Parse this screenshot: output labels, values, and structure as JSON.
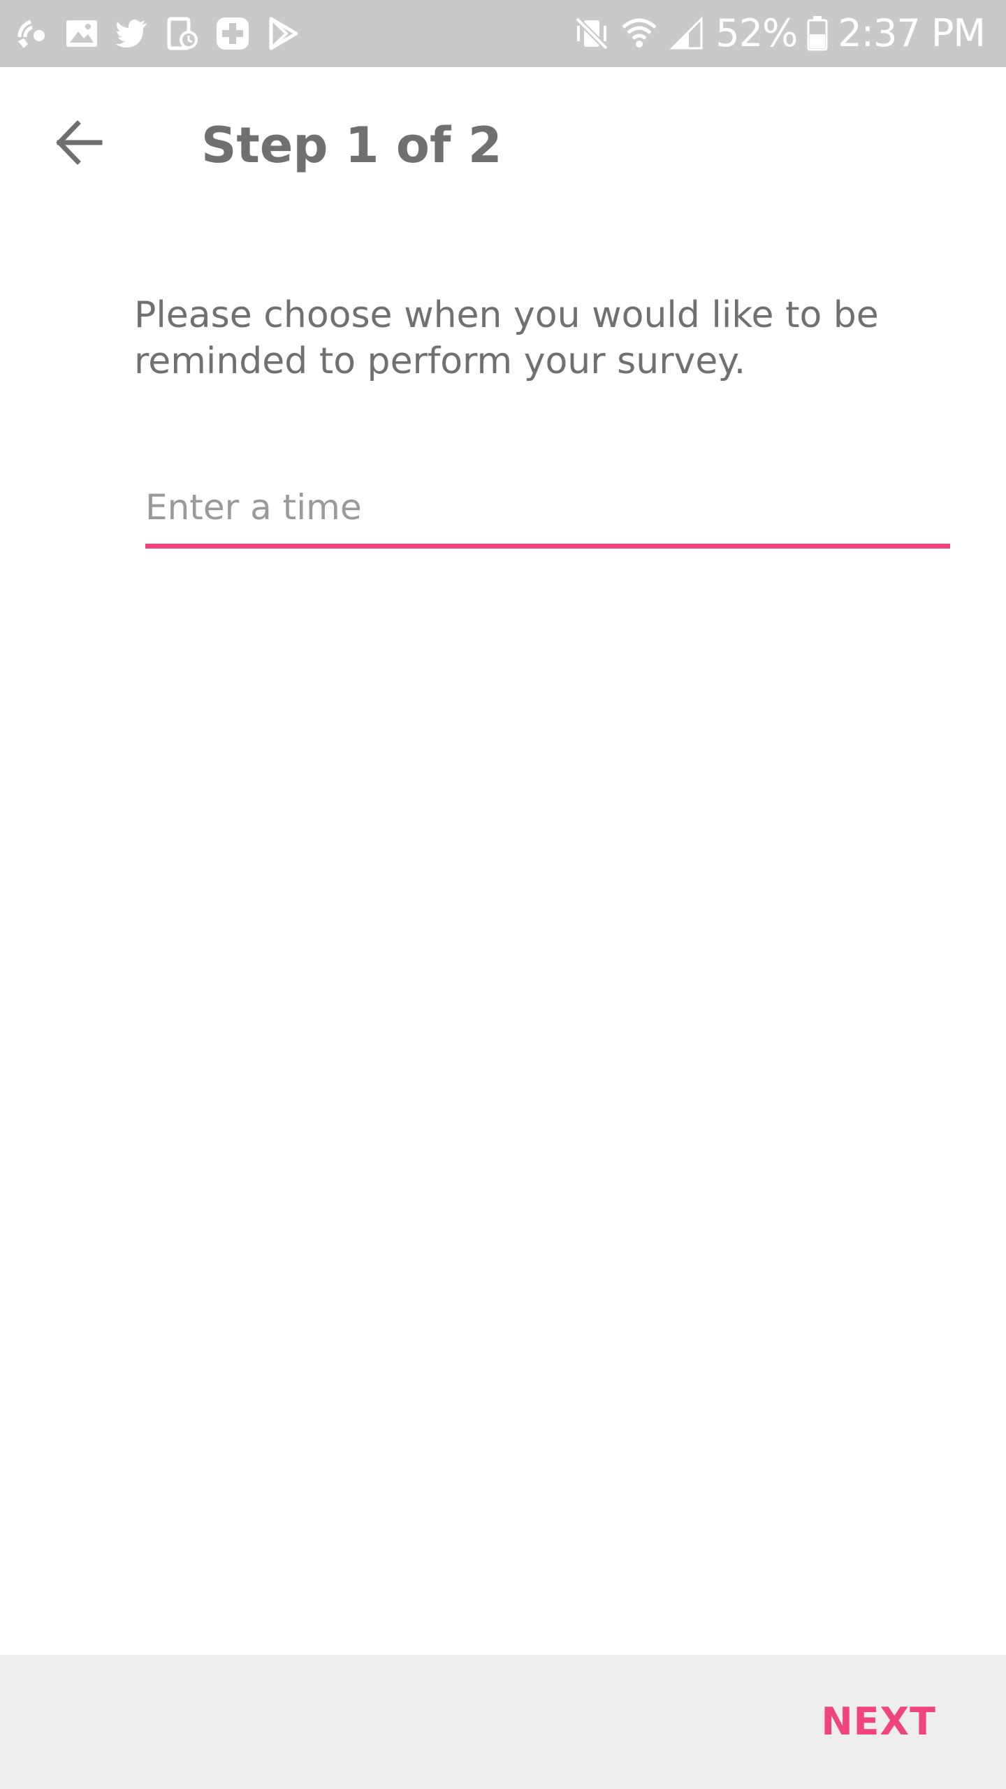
{
  "status_bar": {
    "left_icons": [
      "wifi-call-icon",
      "gallery-icon",
      "twitter-icon",
      "device-clock-icon",
      "plus-app-icon",
      "play-store-icon"
    ],
    "right_icons": [
      "mute-vibrate-icon",
      "wifi-icon",
      "signal-icon",
      "battery-icon"
    ],
    "battery_percent": "52%",
    "time": "2:37 PM"
  },
  "app_bar": {
    "title": "Step 1 of 2"
  },
  "content": {
    "instruction": "Please choose when you would like to be reminded to perform your survey.",
    "time_input": {
      "value": "",
      "placeholder": "Enter a time"
    }
  },
  "bottom_bar": {
    "next_label": "NEXT"
  },
  "colors": {
    "accent": "#f0447e",
    "text": "#707070",
    "status_bar": "#c9c9c9",
    "bottom_bar": "#eeeeef"
  }
}
